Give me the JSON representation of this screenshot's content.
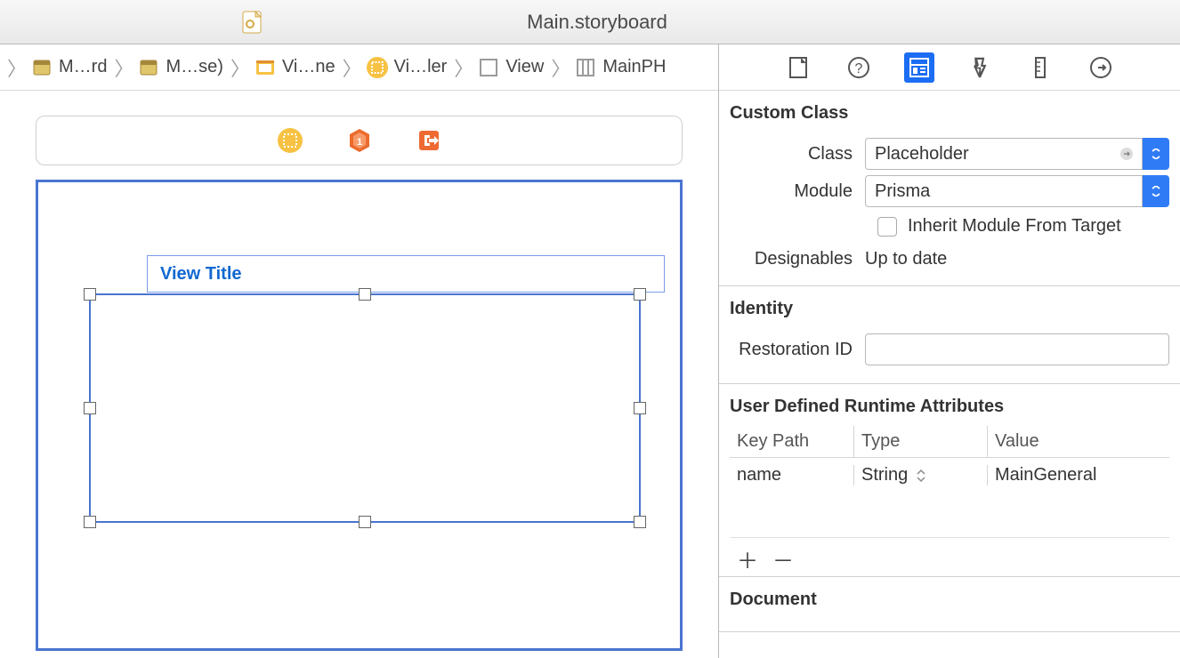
{
  "title": "Main.storyboard",
  "breadcrumb": [
    {
      "label": "M…rd",
      "icon": "storyboard"
    },
    {
      "label": "M…se)",
      "icon": "storyboard"
    },
    {
      "label": "Vi…ne",
      "icon": "scene"
    },
    {
      "label": "Vi…ler",
      "icon": "controller"
    },
    {
      "label": "View",
      "icon": "view"
    },
    {
      "label": "MainPH",
      "icon": "stackview"
    }
  ],
  "canvas": {
    "viewTitle": "View Title"
  },
  "inspector": {
    "sections": {
      "customClass": {
        "heading": "Custom Class",
        "classLabel": "Class",
        "classValue": "Placeholder",
        "moduleLabel": "Module",
        "moduleValue": "Prisma",
        "inheritLabel": "Inherit Module From Target",
        "inheritChecked": false,
        "designablesLabel": "Designables",
        "designablesValue": "Up to date"
      },
      "identity": {
        "heading": "Identity",
        "restorationLabel": "Restoration ID",
        "restorationValue": ""
      },
      "udra": {
        "heading": "User Defined Runtime Attributes",
        "columns": {
          "key": "Key Path",
          "type": "Type",
          "value": "Value"
        },
        "rows": [
          {
            "key": "name",
            "type": "String",
            "value": "MainGeneral"
          }
        ]
      },
      "document": {
        "heading": "Document"
      }
    }
  }
}
